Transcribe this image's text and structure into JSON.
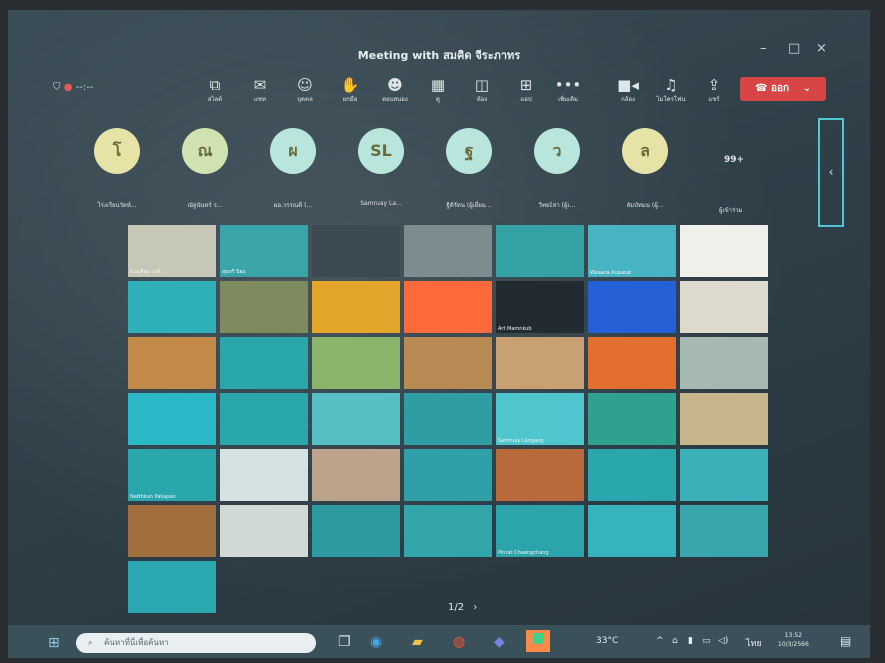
{
  "window": {
    "title": "Meeting with สมคิด จีระภาทร",
    "minimize": "–",
    "maximize": "□",
    "close": "×"
  },
  "status": {
    "timer": "--:--"
  },
  "toolbar": [
    {
      "label": "สไลด์",
      "icon": "slides-icon"
    },
    {
      "label": "แชท",
      "icon": "chat-icon"
    },
    {
      "label": "บุคคล",
      "icon": "people-icon"
    },
    {
      "label": "ยกมือ",
      "icon": "raise-hand-icon"
    },
    {
      "label": "ตอบสนอง",
      "icon": "reactions-icon"
    },
    {
      "label": "ดู",
      "icon": "view-grid-icon"
    },
    {
      "label": "ห้อง",
      "icon": "rooms-icon"
    },
    {
      "label": "แอป",
      "icon": "apps-icon"
    },
    {
      "label": "เพิ่มเติม",
      "icon": "more-icon"
    },
    {
      "label": "กล้อง",
      "icon": "camera-icon"
    },
    {
      "label": "ไมโครโฟน",
      "icon": "microphone-icon"
    },
    {
      "label": "แชร์",
      "icon": "share-icon"
    }
  ],
  "leave": {
    "label": "ออก",
    "icon": "phone-hangup-icon",
    "color": "#d84545"
  },
  "avatars": [
    {
      "initial": "โ",
      "name": "โรงเรียนวัดห์...",
      "color": "#e7e3a6"
    },
    {
      "initial": "ณ",
      "name": "ณัฐนันทร์ ร...",
      "color": "#cfe2b0"
    },
    {
      "initial": "ผ",
      "name": "ผอ.วรรณดี (...",
      "color": "#b9e6dc"
    },
    {
      "initial": "SL",
      "name": "Samruay La...",
      "color": "#b9e6dc"
    },
    {
      "initial": "ฐ",
      "name": "ฐิติรัตน (ผู้เยี่ยม...",
      "color": "#b9e6dc"
    },
    {
      "initial": "ว",
      "name": "วิทยะิสา (ผู้เ...",
      "color": "#b9e6dc"
    },
    {
      "initial": "ล",
      "name": "ลัมบัทมน (ผู้...",
      "color": "#e7e3a6"
    }
  ],
  "more_participants": {
    "count": "99+",
    "label": "ผู้เข้าร่วม"
  },
  "tiles": [
    {
      "name": "ดวงเดือน วงศ์ ...",
      "color": "#c7c7b7"
    },
    {
      "name": "สุนทรี นิยม",
      "color": "#3aa5a9"
    },
    {
      "name": "",
      "color": "#3b4a52"
    },
    {
      "name": "",
      "color": "#7d8d8f"
    },
    {
      "name": "",
      "color": "#35a3a6"
    },
    {
      "name": "Wasana Auparat",
      "color": "#46b4c3"
    },
    {
      "name": "",
      "color": "#f0f0ea"
    },
    {
      "name": "",
      "color": "#2fb0b7"
    },
    {
      "name": "",
      "color": "#7d8b5e"
    },
    {
      "name": "",
      "color": "#e4a62a"
    },
    {
      "name": "",
      "color": "#ff6a3d"
    },
    {
      "name": "Art Mamnkub",
      "color": "#222b30"
    },
    {
      "name": "",
      "color": "#2560d6"
    },
    {
      "name": "",
      "color": "#ddd9cc"
    },
    {
      "name": "",
      "color": "#c38a4a"
    },
    {
      "name": "",
      "color": "#2aa6ad"
    },
    {
      "name": "",
      "color": "#8ab36c"
    },
    {
      "name": "",
      "color": "#b88b55"
    },
    {
      "name": "",
      "color": "#c9a074"
    },
    {
      "name": "",
      "color": "#e36f2f"
    },
    {
      "name": "",
      "color": "#a5b8b2"
    },
    {
      "name": "",
      "color": "#2bb8c6"
    },
    {
      "name": "",
      "color": "#2aa6ad"
    },
    {
      "name": "",
      "color": "#55bfc4"
    },
    {
      "name": "",
      "color": "#2e9da4"
    },
    {
      "name": "Samruay Langang",
      "color": "#4fc5ce"
    },
    {
      "name": "",
      "color": "#2ea28e"
    },
    {
      "name": "",
      "color": "#c7b58b"
    },
    {
      "name": "Natthkun Pakapan",
      "color": "#2aa6ad"
    },
    {
      "name": "",
      "color": "#d6e2e1"
    },
    {
      "name": "",
      "color": "#bba38c"
    },
    {
      "name": "",
      "color": "#2fa0a8"
    },
    {
      "name": "",
      "color": "#b96a3b"
    },
    {
      "name": "",
      "color": "#2aa6ad"
    },
    {
      "name": "",
      "color": "#3bb0b8"
    },
    {
      "name": "",
      "color": "#a16e3d"
    },
    {
      "name": "",
      "color": "#d1d9d4"
    },
    {
      "name": "",
      "color": "#2d9aa1"
    },
    {
      "name": "",
      "color": "#33a6ac"
    },
    {
      "name": "Pinrat Chaengchang",
      "color": "#2ba4ab"
    },
    {
      "name": "",
      "color": "#37b4bb"
    },
    {
      "name": "",
      "color": "#39a6ad"
    },
    {
      "name": "",
      "color": "#2ca9b0"
    }
  ],
  "pager": {
    "text": "1/2",
    "next": "›"
  },
  "taskbar": {
    "search_placeholder": "ค้นหาที่นี่เพื่อค้นหา",
    "temperature": "33°C",
    "lang": "ไทย",
    "time": "13:52",
    "date": "10/3/2566"
  }
}
